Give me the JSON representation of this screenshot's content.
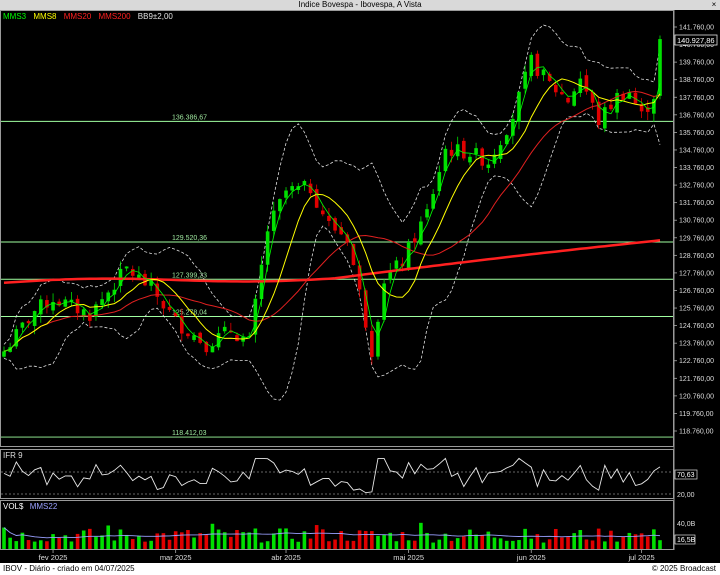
{
  "window": {
    "title": "Indice Bovespa - Ibovespa, A Vista",
    "close_glyph": "×"
  },
  "legend": [
    {
      "label": "MMS3",
      "color": "#00ff00"
    },
    {
      "label": "MMS8",
      "color": "#ffff00"
    },
    {
      "label": "MMS20",
      "color": "#ff2020"
    },
    {
      "label": "MMS200",
      "color": "#ff2020"
    },
    {
      "label": "BB9±2,00",
      "color": "#e0e0e0"
    }
  ],
  "price_panel": {
    "y_ticks": [
      "141.760,00",
      "140.760,00",
      "139.760,00",
      "138.760,00",
      "137.760,00",
      "136.760,00",
      "135.760,00",
      "134.760,00",
      "133.760,00",
      "132.760,00",
      "131.760,00",
      "130.760,00",
      "129.760,00",
      "128.760,00",
      "127.760,00",
      "126.760,00",
      "125.760,00",
      "124.760,00",
      "123.760,00",
      "122.760,00",
      "121.760,00",
      "120.760,00",
      "119.760,00",
      "118.760,00"
    ],
    "last_price": "140.927,86",
    "levels": [
      "136.386,67",
      "129.520,36",
      "127.399,23",
      "125.278,04",
      "118.412,03"
    ]
  },
  "ifr_panel": {
    "label": "IFR 9",
    "levels": [
      "80,00",
      "20,00"
    ],
    "last_value": "70,63"
  },
  "vol_panel": {
    "label": "VOL$",
    "ma_label": "MMS22",
    "top_value": "40,0B",
    "last_value": "16,5B"
  },
  "x_axis": {
    "months": [
      "fev 2025",
      "mar 2025",
      "abr 2025",
      "mai 2025",
      "jun 2025",
      "jul 2025"
    ]
  },
  "footer": {
    "left": "IBOV - Diário - criado em 04/07/2025",
    "right": "© 2025 Broadcast"
  },
  "colors": {
    "up": "#00e000",
    "down": "#e00000",
    "mms3": "#00ff00",
    "mms8": "#ffff00",
    "mms20": "#ff2020",
    "mms200": "#ff2020",
    "bands": "#e0e0e0",
    "level_line": "#a0ffa0"
  }
}
